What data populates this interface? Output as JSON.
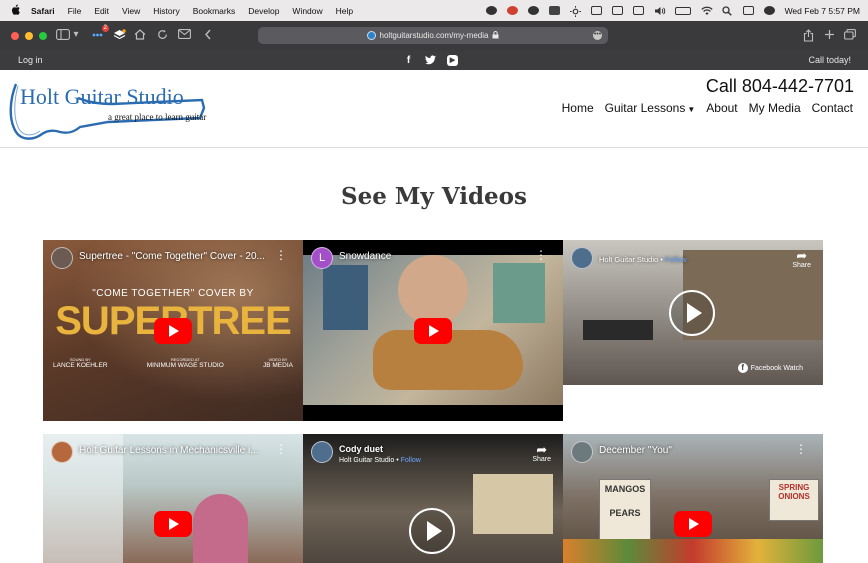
{
  "menubar": {
    "apple": "",
    "items": [
      "Safari",
      "File",
      "Edit",
      "View",
      "History",
      "Bookmarks",
      "Develop",
      "Window",
      "Help"
    ],
    "datetime": "Wed Feb 7  5:57 PM"
  },
  "browser": {
    "url": "holtguitarstudio.com/my-media",
    "extension_badge": "2"
  },
  "topbar": {
    "login": "Log in",
    "social": [
      "facebook-icon",
      "twitter-icon",
      "youtube-icon"
    ],
    "call_today": "Call today!"
  },
  "header": {
    "logo_title": "Holt Guitar Studio",
    "logo_tagline": "a great place to learn guitar",
    "phone": "Call 804-442-7701",
    "nav": [
      "Home",
      "Guitar Lessons",
      "About",
      "My Media",
      "Contact"
    ]
  },
  "main": {
    "title": "See My Videos",
    "videos": [
      {
        "title": "Supertree - \"Come Together\" Cover - 20...",
        "type": "youtube",
        "overlay_line1": "\"COME TOGETHER\" COVER BY",
        "overlay_big": "SUPERTREE",
        "credits": [
          {
            "role": "SOUND BY",
            "name": "LANCE KOEHLER"
          },
          {
            "role": "RECORDED AT",
            "name": "MINIMUM WAGE STUDIO"
          },
          {
            "role": "VIDEO BY",
            "name": "JB MEDIA"
          }
        ],
        "avatar_letter": ""
      },
      {
        "title": "Snowdance",
        "type": "youtube",
        "avatar_letter": "L"
      },
      {
        "title": "Holt Guitar Studio",
        "follow": "Follow",
        "separator": " • ",
        "type": "facebook",
        "share": "Share",
        "watch_label": "Facebook Watch"
      },
      {
        "title": "Holt Guitar Lessons in Mechanicsville i...",
        "type": "youtube"
      },
      {
        "title": "Cody duet",
        "subtitle": "Holt Guitar Studio",
        "follow": "Follow",
        "separator": " • ",
        "type": "facebook",
        "share": "Share"
      },
      {
        "title": "December \"You\"",
        "type": "youtube",
        "sign_left": "MANGOS",
        "sign_left2": "PEARS",
        "sign_right": "SPRING ONIONS"
      }
    ]
  },
  "colors": {
    "chrome_bg": "#3a3a3c",
    "site_topbar": "#3c3b3e",
    "logo_blue": "#2b6cb0",
    "youtube_red": "#ff0000"
  }
}
